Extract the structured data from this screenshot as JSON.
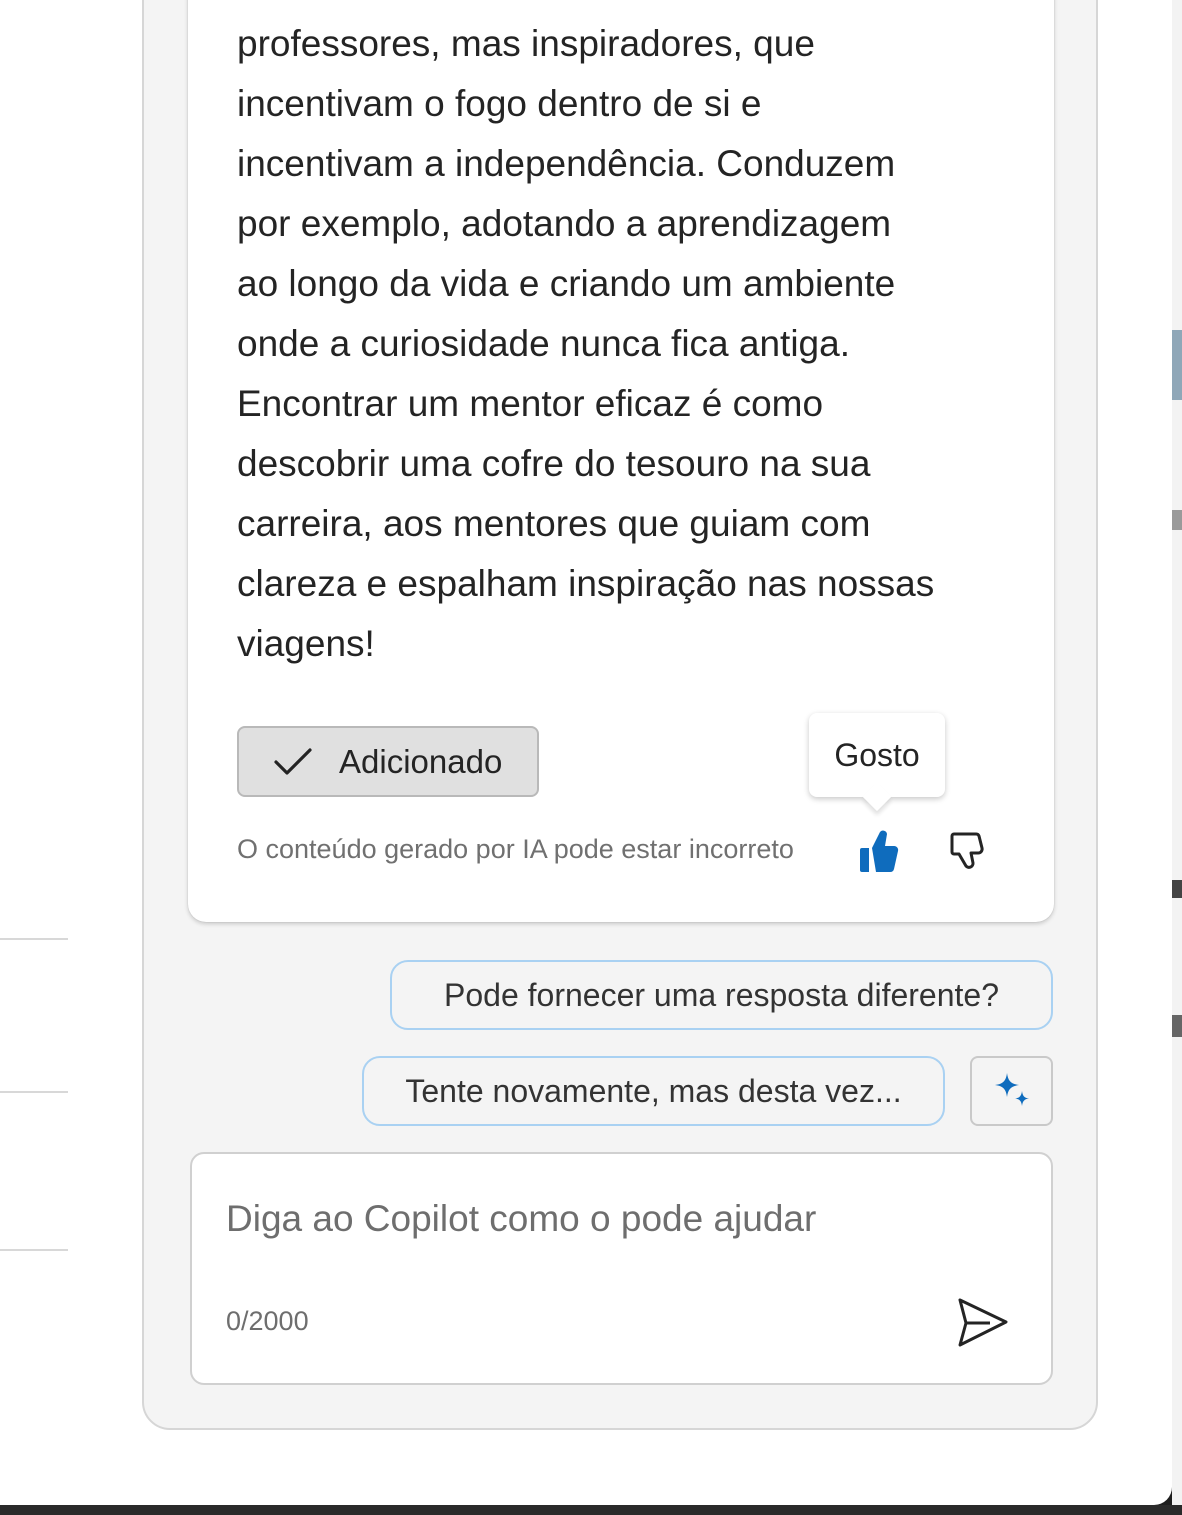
{
  "message": {
    "text": "professores, mas inspiradores, que\nincentivam o fogo dentro de si e\nincentivam a independência. Conduzem\npor exemplo, adotando a aprendizagem\nao longo da vida e criando um ambiente\nonde a curiosidade nunca fica antiga.\nEncontrar um mentor eficaz é como\ndescobrir uma cofre do tesouro na sua\ncarreira, aos mentores que guiam com\nclareza e espalham inspiração nas nossas\nviagens!",
    "added_label": "Adicionado",
    "disclaimer": "O conteúdo gerado por IA pode estar incorreto",
    "tooltip": "Gosto"
  },
  "suggestions": [
    "Pode fornecer uma resposta diferente?",
    "Tente novamente, mas desta vez..."
  ],
  "composer": {
    "placeholder": "Diga ao Copilot como o pode ajudar",
    "value": "",
    "counter": "0/2000"
  },
  "colors": {
    "accent": "#0f6cbd",
    "suggestion_border": "#a9d1f2"
  },
  "icons": {
    "added": "checkmark-icon",
    "like": "thumbs-up-icon",
    "dislike": "thumbs-down-icon",
    "suggestions": "sparkle-icon",
    "send": "send-icon"
  }
}
